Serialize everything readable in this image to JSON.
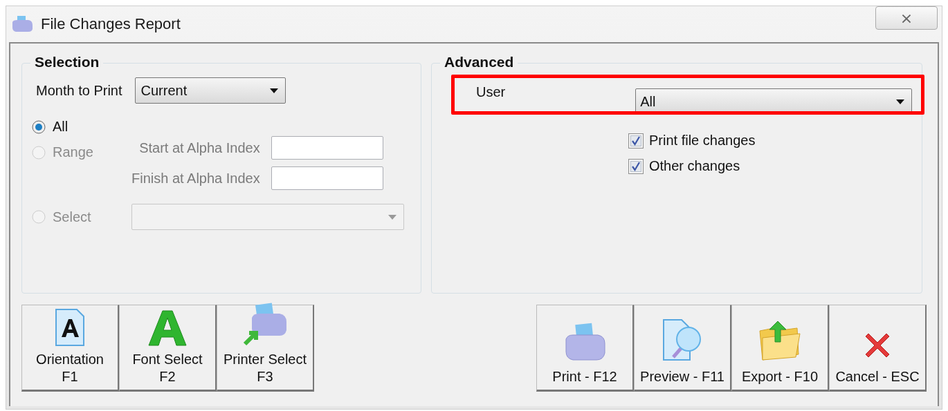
{
  "window": {
    "title": "File Changes Report",
    "close": "⨯"
  },
  "selection": {
    "title": "Selection",
    "month": {
      "label": "Month to Print",
      "value": "Current"
    },
    "radios": [
      {
        "label": "All",
        "selected": true,
        "disabled": false
      },
      {
        "label": "Range",
        "selected": false,
        "disabled": true
      },
      {
        "label": "Select",
        "selected": false,
        "disabled": true
      }
    ],
    "range_fields": [
      {
        "label": "Start at Alpha Index"
      },
      {
        "label": "Finish at Alpha Index"
      }
    ],
    "select_dropdown": {
      "disabled": true
    }
  },
  "advanced": {
    "title": "Advanced",
    "user": {
      "label": "User",
      "value": "All",
      "highlighted": true
    },
    "checkboxes": [
      {
        "label": "Print file changes",
        "checked": true
      },
      {
        "label": "Other changes",
        "checked": true
      }
    ]
  },
  "left_buttons": [
    {
      "kind": "orientation",
      "lines": [
        "Orientation",
        "F1"
      ]
    },
    {
      "kind": "font",
      "lines": [
        "Font Select",
        "F2"
      ]
    },
    {
      "kind": "printer",
      "lines": [
        "Printer Select",
        "F3"
      ]
    }
  ],
  "right_buttons": [
    {
      "kind": "print",
      "label": "Print - F12"
    },
    {
      "kind": "preview",
      "label": "Preview - F11"
    },
    {
      "kind": "export",
      "label": "Export - F10"
    },
    {
      "kind": "cancel",
      "label": "Cancel - ESC"
    }
  ]
}
